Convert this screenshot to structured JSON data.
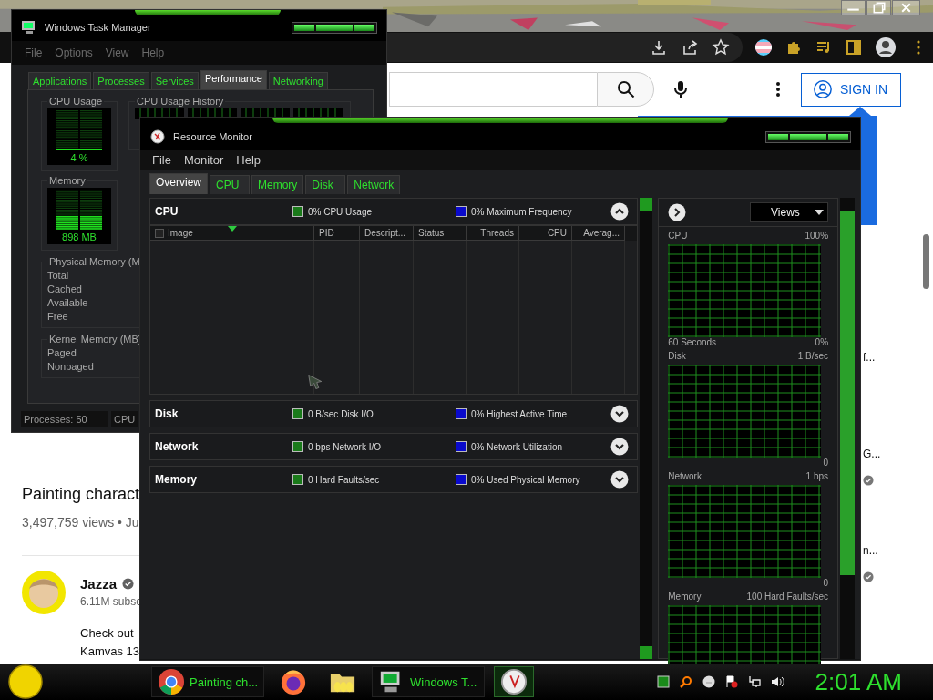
{
  "browser": {
    "sign_in": "SIGN IN",
    "video": {
      "title": "Painting charact",
      "views": "3,497,759 views • Ju",
      "channel": "Jazza",
      "subscribers": "6.11M subsc",
      "description": [
        "Check out",
        "Kamvas 13"
      ]
    },
    "side_snippets": [
      {
        "text": "f...",
        "verified": false
      },
      {
        "text": "G...",
        "verified": true
      },
      {
        "text": "n...",
        "verified": true
      }
    ]
  },
  "task_manager": {
    "title": "Windows Task Manager",
    "menu": [
      "File",
      "Options",
      "View",
      "Help"
    ],
    "tabs": [
      {
        "label": "Applications",
        "selected": false
      },
      {
        "label": "Processes",
        "selected": false
      },
      {
        "label": "Services",
        "selected": false
      },
      {
        "label": "Performance",
        "selected": true
      },
      {
        "label": "Networking",
        "selected": false
      }
    ],
    "cpu_usage": {
      "label": "CPU Usage",
      "reading": "4 %"
    },
    "memory": {
      "label": "Memory",
      "reading": "898 MB"
    },
    "history_label": "CPU Usage History",
    "physical_memory": {
      "label": "Physical Memory (M",
      "rows": [
        "Total",
        "Cached",
        "Available",
        "Free"
      ]
    },
    "kernel_memory": {
      "label": "Kernel Memory (MB)",
      "rows": [
        "Paged",
        "Nonpaged"
      ]
    },
    "status": [
      "Processes: 50",
      "CPU"
    ]
  },
  "resource_monitor": {
    "title": "Resource Monitor",
    "menu": [
      "File",
      "Monitor",
      "Help"
    ],
    "tabs": [
      {
        "label": "Overview",
        "selected": true
      },
      {
        "label": "CPU",
        "selected": false
      },
      {
        "label": "Memory",
        "selected": false
      },
      {
        "label": "Disk",
        "selected": false
      },
      {
        "label": "Network",
        "selected": false
      }
    ],
    "sections": [
      {
        "name": "CPU",
        "expanded": true,
        "metric_1": "0% CPU Usage",
        "metric_2": "0% Maximum Frequency"
      },
      {
        "name": "Disk",
        "expanded": false,
        "metric_1": "0 B/sec Disk I/O",
        "metric_2": "0% Highest Active Time"
      },
      {
        "name": "Network",
        "expanded": false,
        "metric_1": "0 bps Network I/O",
        "metric_2": "0% Network Utilization"
      },
      {
        "name": "Memory",
        "expanded": false,
        "metric_1": "0 Hard Faults/sec",
        "metric_2": "0% Used Physical Memory"
      }
    ],
    "cpu_table": {
      "select_all_checked": false,
      "columns": [
        "Image",
        "PID",
        "Descript...",
        "Status",
        "Threads",
        "CPU",
        "Averag..."
      ]
    },
    "views": "Views",
    "graphs": [
      {
        "name": "CPU",
        "max": "100%",
        "span": "60 Seconds",
        "min": "0%"
      },
      {
        "name": "Disk",
        "max": "1 B/sec",
        "min": "0"
      },
      {
        "name": "Network",
        "max": "1 bps",
        "min": "0"
      },
      {
        "name": "Memory",
        "max": "100 Hard Faults/sec"
      }
    ]
  },
  "taskbar": {
    "tasks": [
      {
        "kind": "chrome",
        "label": "Painting ch...",
        "active": false
      },
      {
        "kind": "firefox",
        "active": false
      },
      {
        "kind": "folder",
        "active": false
      },
      {
        "kind": "taskmgr",
        "label": "Windows T...",
        "active": false
      },
      {
        "kind": "resmon",
        "active": true
      }
    ],
    "clock": "2:01 AM"
  }
}
